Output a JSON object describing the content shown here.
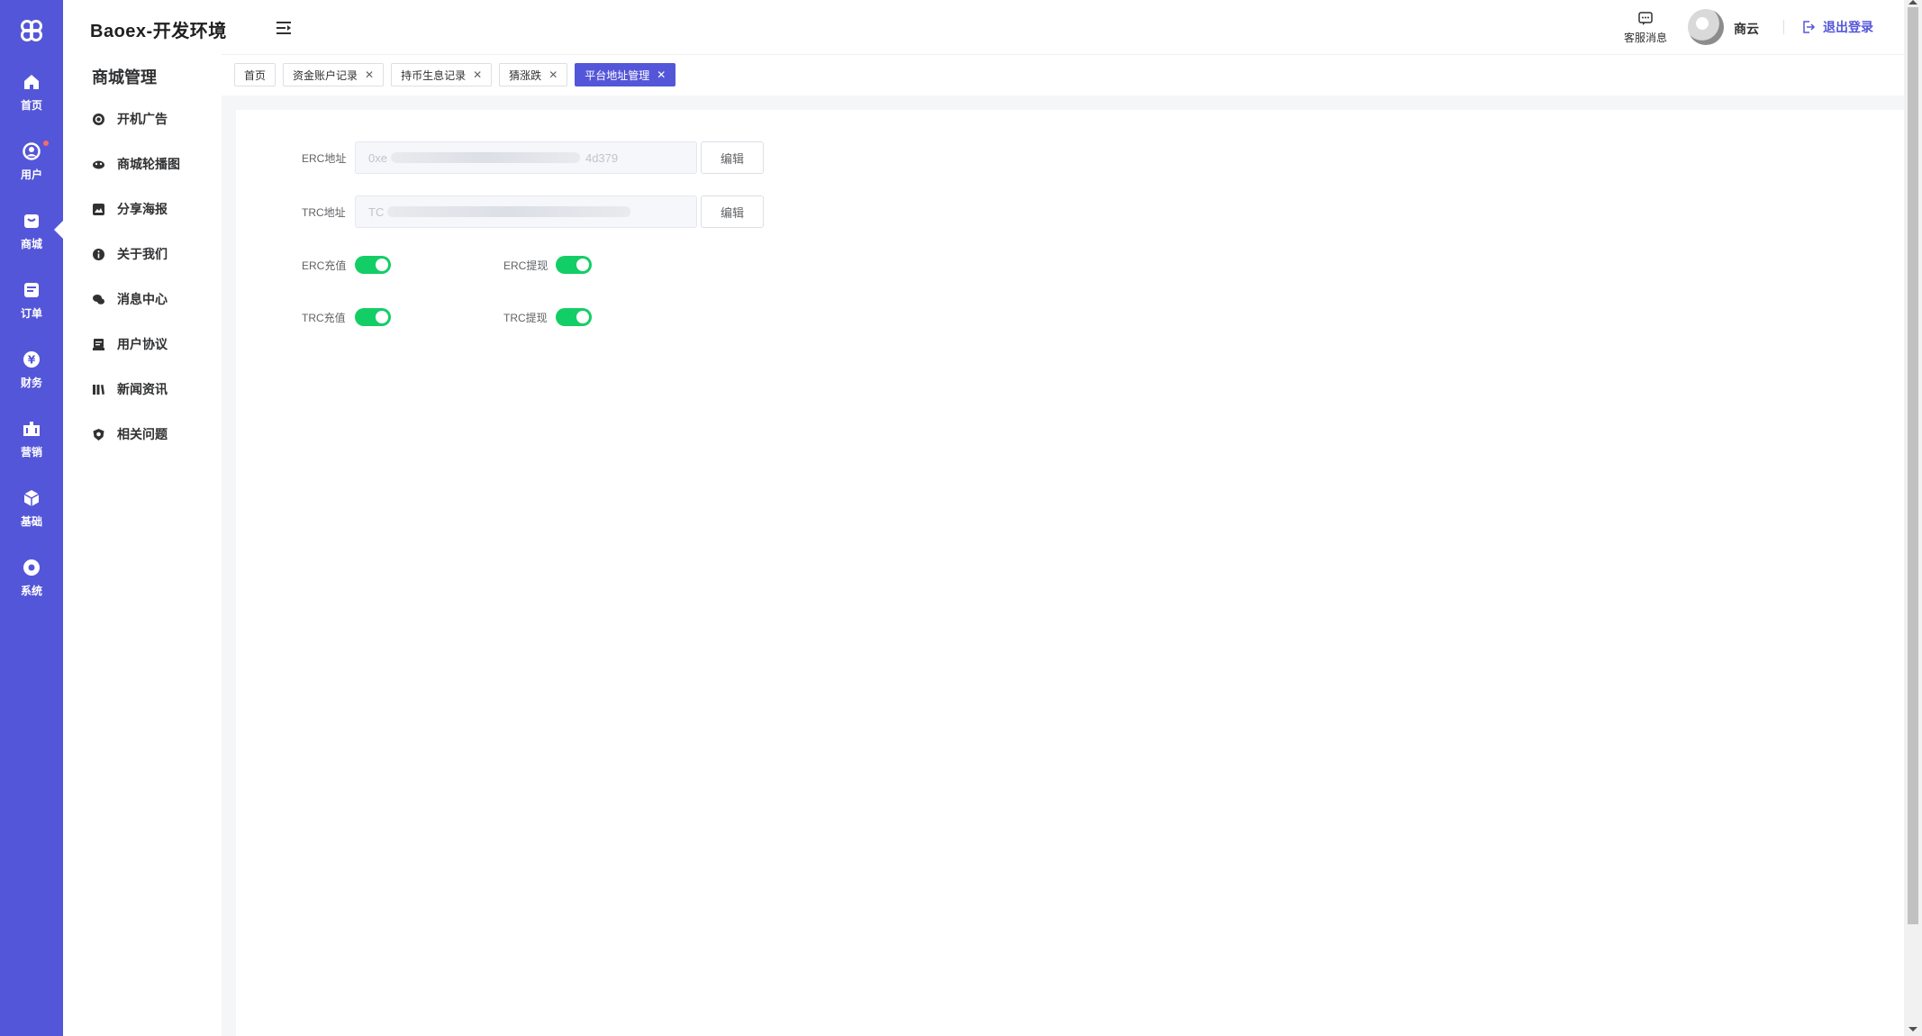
{
  "app": {
    "brand": "Baoex-开发环境"
  },
  "rail": {
    "items": [
      {
        "label": "首页",
        "icon": "home-icon"
      },
      {
        "label": "用户",
        "icon": "user-icon",
        "badge": true
      },
      {
        "label": "商城",
        "icon": "shop-icon",
        "active": true
      },
      {
        "label": "订单",
        "icon": "order-icon"
      },
      {
        "label": "财务",
        "icon": "finance-icon"
      },
      {
        "label": "营销",
        "icon": "marketing-icon"
      },
      {
        "label": "基础",
        "icon": "cube-icon"
      },
      {
        "label": "系统",
        "icon": "settings-icon"
      }
    ]
  },
  "sidebar": {
    "title": "商城管理",
    "items": [
      {
        "label": "开机广告",
        "icon": "power-ad-icon"
      },
      {
        "label": "商城轮播图",
        "icon": "carousel-icon"
      },
      {
        "label": "分享海报",
        "icon": "image-icon"
      },
      {
        "label": "关于我们",
        "icon": "info-icon"
      },
      {
        "label": "消息中心",
        "icon": "chat-icon"
      },
      {
        "label": "用户协议",
        "icon": "agreement-icon"
      },
      {
        "label": "新闻资讯",
        "icon": "news-icon"
      },
      {
        "label": "相关问题",
        "icon": "question-icon"
      }
    ]
  },
  "header": {
    "service_label": "客服消息",
    "username": "商云",
    "logout_label": "退出登录"
  },
  "tabs": [
    {
      "label": "首页",
      "closable": false,
      "active": false
    },
    {
      "label": "资金账户记录",
      "closable": true,
      "active": false
    },
    {
      "label": "持币生息记录",
      "closable": true,
      "active": false
    },
    {
      "label": "猜涨跌",
      "closable": true,
      "active": false
    },
    {
      "label": "平台地址管理",
      "closable": true,
      "active": true
    }
  ],
  "form": {
    "erc_label": "ERC地址",
    "erc_value": "0xe",
    "erc_value_tail": "4d379",
    "trc_label": "TRC地址",
    "trc_value": "TC",
    "edit_label": "编辑",
    "erc_deposit_label": "ERC充值",
    "erc_deposit_on": true,
    "erc_withdraw_label": "ERC提现",
    "erc_withdraw_on": true,
    "trc_deposit_label": "TRC充值",
    "trc_deposit_on": true,
    "trc_withdraw_label": "TRC提现",
    "trc_withdraw_on": true
  },
  "colors": {
    "primary": "#5456d9",
    "switch_on": "#13ce66",
    "badge": "#f56c6c"
  }
}
